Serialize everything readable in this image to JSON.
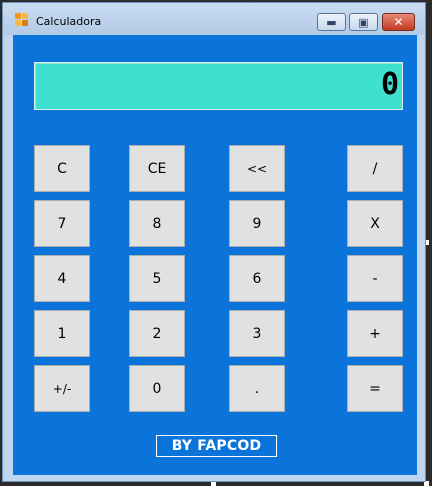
{
  "window": {
    "title": "Calculadora"
  },
  "title_buttons": {
    "minimize_icon": "minimize-icon",
    "maximize_icon": "maximize-icon",
    "close_icon": "close-icon"
  },
  "display": {
    "value": "0"
  },
  "keys": {
    "c": "C",
    "ce": "CE",
    "backspace": "<<",
    "divide": "/",
    "seven": "7",
    "eight": "8",
    "nine": "9",
    "multiply": "X",
    "four": "4",
    "five": "5",
    "six": "6",
    "minus": "-",
    "one": "1",
    "two": "2",
    "three": "3",
    "plus": "+",
    "sign": "+/-",
    "zero": "0",
    "decimal": ".",
    "equals": "="
  },
  "footer": {
    "credit": "BY FAPCOD"
  },
  "colors": {
    "client_background": "#0a74da",
    "display_background": "#40e0d0",
    "key_background": "#e1e1e1",
    "credit_text": "#ffffff"
  }
}
